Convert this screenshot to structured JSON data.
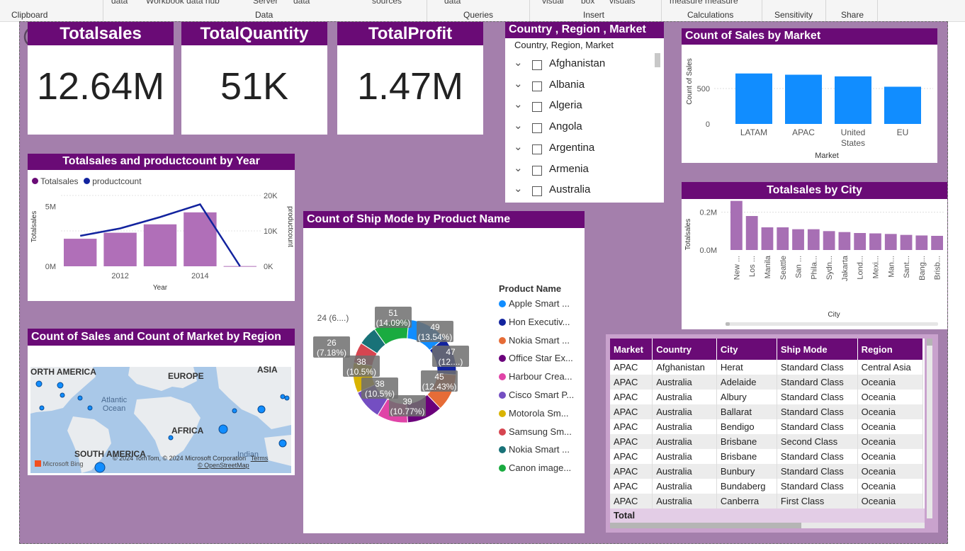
{
  "ribbon": {
    "top_items": [
      "data",
      "Workbook data hub",
      "Server",
      "data",
      "sources",
      "data",
      "visual",
      "box",
      "visuals",
      "measure measure"
    ],
    "groups": [
      "Clipboard",
      "Data",
      "Queries",
      "Insert",
      "Calculations",
      "Sensitivity",
      "Share"
    ]
  },
  "cards": [
    {
      "title": "Totalsales",
      "value": "12.64M"
    },
    {
      "title": "TotalQuantity",
      "value": "51K"
    },
    {
      "title": "TotalProfit",
      "value": "1.47M"
    }
  ],
  "slicer": {
    "title": "Country , Region , Market",
    "subheader": "Country, Region, Market",
    "items": [
      "Afghanistan",
      "Albania",
      "Algeria",
      "Angola",
      "Argentina",
      "Armenia",
      "Australia"
    ]
  },
  "market_chart": {
    "title": "Count of Sales by Market",
    "chart_data": {
      "type": "bar",
      "categories": [
        "LATAM",
        "APAC",
        "United States",
        "EU"
      ],
      "values": [
        780,
        765,
        745,
        620
      ],
      "ylabel": "Count of Sales",
      "xlabel": "Market",
      "ylim": [
        0,
        800
      ],
      "ticks": [
        "0",
        "500"
      ],
      "color": "#118dff"
    }
  },
  "year_chart": {
    "title": "Totalsales and productcount by Year",
    "legend": [
      "Totalsales",
      "productcount"
    ],
    "chart_data": {
      "type": "bar",
      "categories": [
        "2011",
        "2012",
        "2013",
        "2014",
        "2015"
      ],
      "series": [
        {
          "name": "Totalsales",
          "values": [
            2.3,
            2.8,
            3.5,
            4.5,
            0.02
          ],
          "color": "#b06fb8"
        },
        {
          "name": "productcount",
          "values": [
            8600,
            10700,
            13900,
            17500,
            0
          ],
          "color": "#12239e"
        }
      ],
      "ylabel": "Totalsales",
      "y2label": "productcount",
      "xlabel": "Year",
      "ylim": [
        0,
        6.5
      ],
      "y2lim": [
        0,
        22000
      ],
      "left_ticks": [
        "0M",
        "5M"
      ],
      "right_ticks": [
        "0K",
        "10K",
        "20K"
      ],
      "x_ticks": [
        "2012",
        "2014"
      ]
    }
  },
  "city_chart": {
    "title": "Totalsales by City",
    "chart_data": {
      "type": "bar",
      "categories": [
        "New ...",
        "Los ...",
        "Manila",
        "Seattle",
        "San ...",
        "Phila...",
        "Sydn...",
        "Jakarta",
        "Lond...",
        "Mexi...",
        "Man...",
        "Sant...",
        "Bang...",
        "Brisb..."
      ],
      "values": [
        0.26,
        0.18,
        0.12,
        0.12,
        0.11,
        0.11,
        0.1,
        0.095,
        0.09,
        0.088,
        0.085,
        0.08,
        0.077,
        0.075
      ],
      "ylabel": "Totalsales",
      "xlabel": "City",
      "ylim": [
        0,
        0.3
      ],
      "ticks": [
        "0.0M",
        "0.2M"
      ],
      "color": "#a76fb4"
    }
  },
  "ship_chart": {
    "title": "Count of Ship Mode by Product Name",
    "legend_title": "Product Name",
    "chart_data": {
      "type": "pie",
      "labels": [
        "Apple Smart ...",
        "Hon Executiv...",
        "Nokia Smart ...",
        "Office Star Ex...",
        "Harbour Crea...",
        "Cisco Smart P...",
        "Motorola Sm...",
        "Samsung Sm...",
        "Nokia Smart ...",
        "Canon image..."
      ],
      "values": [
        51,
        49,
        47,
        45,
        39,
        38,
        38,
        26,
        24,
        45
      ],
      "colors": [
        "#118dff",
        "#12239e",
        "#e66c37",
        "#6b007b",
        "#e044a7",
        "#744ec2",
        "#d9b300",
        "#d64550",
        "#197278",
        "#1aab40"
      ],
      "data_labels": [
        "51\n(14.09%)",
        "49\n(13.54%)",
        "47\n(12....)",
        "45\n(12.43%)",
        "39\n(10.77%)",
        "38\n(10.5%)",
        "38\n(10.5%)",
        "26\n(7.18%)",
        "24 (6....)"
      ]
    }
  },
  "map": {
    "title": "Count of Sales and Count of Market by Region",
    "labels": [
      "ORTH AMERICA",
      "EUROPE",
      "ASIA",
      "Atlantic\nOcean",
      "AFRICA",
      "SOUTH AMERICA",
      "Indian"
    ],
    "attribution": "© 2024 TomTom, © 2024 Microsoft Corporation",
    "terms": "Terms",
    "osm": "© OpenStreetMap",
    "bing": "Microsoft Bing"
  },
  "table": {
    "columns": [
      "Market",
      "Country",
      "City",
      "Ship Mode",
      "Region"
    ],
    "rows": [
      [
        "APAC",
        "Afghanistan",
        "Herat",
        "Standard Class",
        "Central Asia"
      ],
      [
        "APAC",
        "Australia",
        "Adelaide",
        "Standard Class",
        "Oceania"
      ],
      [
        "APAC",
        "Australia",
        "Albury",
        "Standard Class",
        "Oceania"
      ],
      [
        "APAC",
        "Australia",
        "Ballarat",
        "Standard Class",
        "Oceania"
      ],
      [
        "APAC",
        "Australia",
        "Bendigo",
        "Standard Class",
        "Oceania"
      ],
      [
        "APAC",
        "Australia",
        "Brisbane",
        "Second Class",
        "Oceania"
      ],
      [
        "APAC",
        "Australia",
        "Brisbane",
        "Standard Class",
        "Oceania"
      ],
      [
        "APAC",
        "Australia",
        "Bunbury",
        "Standard Class",
        "Oceania"
      ],
      [
        "APAC",
        "Australia",
        "Bundaberg",
        "Standard Class",
        "Oceania"
      ],
      [
        "APAC",
        "Australia",
        "Canberra",
        "First Class",
        "Oceania"
      ]
    ],
    "total_label": "Total"
  }
}
